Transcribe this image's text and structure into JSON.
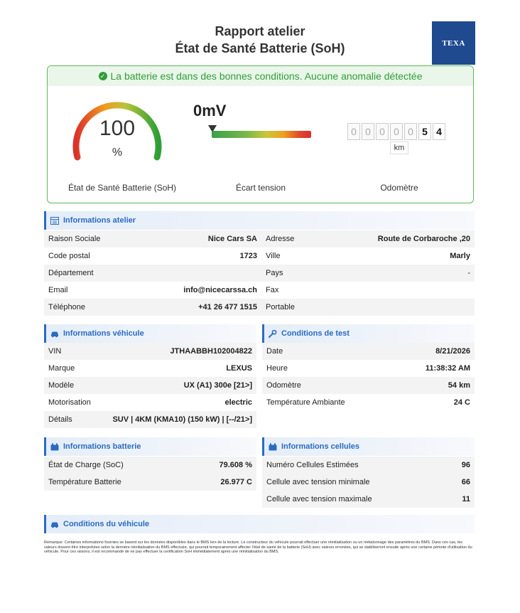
{
  "header": {
    "title_line1": "Rapport atelier",
    "title_line2": "État de Santé Batterie (SoH)",
    "logo_text": "TEXA"
  },
  "status": {
    "message": "La batterie est dans des bonnes conditions. Aucune anomalie détectée",
    "color": "#2e9e36"
  },
  "soh": {
    "value": "100",
    "unit": "%",
    "label": "État de Santé Batterie (SoH)",
    "level": 1.0
  },
  "voltage": {
    "value": "0mV",
    "label": "Écart tension",
    "marker_fraction": 0.0
  },
  "odometer": {
    "digits": [
      "0",
      "0",
      "0",
      "0",
      "0",
      "5",
      "4"
    ],
    "unit": "km",
    "label": "Odomètre"
  },
  "atelier": {
    "title": "Informations atelier",
    "rows": [
      {
        "k1": "Raison Sociale",
        "v1": "Nice Cars SA",
        "k2": "Adresse",
        "v2": "Route de Corbaroche ,20"
      },
      {
        "k1": "Code postal",
        "v1": "1723",
        "k2": "Ville",
        "v2": "Marly"
      },
      {
        "k1": "Département",
        "v1": "",
        "k2": "Pays",
        "v2": "-"
      },
      {
        "k1": "Email",
        "v1": "info@nicecarssa.ch",
        "k2": "Fax",
        "v2": ""
      },
      {
        "k1": "Téléphone",
        "v1": "+41 26 477 1515",
        "k2": "Portable",
        "v2": ""
      }
    ]
  },
  "vehicule": {
    "title": "Informations véhicule",
    "rows": [
      {
        "k": "VIN",
        "v": "JTHAABBH102004822"
      },
      {
        "k": "Marque",
        "v": "LEXUS"
      },
      {
        "k": "Modèle",
        "v": "UX (A1) 300e [21>]"
      },
      {
        "k": "Motorisation",
        "v": "electric"
      },
      {
        "k": "Détails",
        "v": "SUV | 4KM (KMA10) (150 kW) | [--/21>]"
      }
    ]
  },
  "test": {
    "title": "Conditions de test",
    "rows": [
      {
        "k": "Date",
        "v": "8/21/2026"
      },
      {
        "k": "Heure",
        "v": "11:38:32 AM"
      },
      {
        "k": "Odomètre",
        "v": "54 km"
      },
      {
        "k": "Température Ambiante",
        "v": "24 C"
      }
    ]
  },
  "batterie": {
    "title": "Informations batterie",
    "rows": [
      {
        "k": "État de Charge (SoC)",
        "v": "79.608 %"
      },
      {
        "k": "Température Batterie",
        "v": "26.977 C"
      }
    ]
  },
  "cellules": {
    "title": "Informations cellules",
    "rows": [
      {
        "k": "Numéro Cellules Estimées",
        "v": "96"
      },
      {
        "k": "Cellule avec tension minimale",
        "v": "66"
      },
      {
        "k": "Cellule avec tension maximale",
        "v": "11"
      }
    ]
  },
  "conditions": {
    "title": "Conditions du véhicule"
  },
  "note": "Remarque: Certaines informations fournies se basent sur les données disponibles dans le BMS lors de la lecture. Le constructeur du véhicule pourrait effectuer une réinitialisation ou un réétalonnage des paramètres du BMS. Dans ces cas, les valeurs doivent être interprétées selon la dernière réinitialisation du BMS effectuée, qui pourrait temporairement affecter l'état de santé de la batterie (SoH) avec valeurs erronées, qui se stabiliseront ensuite après une certaine période d'utilisation du véhicule. Pour ces raisons, il est recommandé de ne pas effectuer la certification SoH immédiatement après une réinitialisation du BMS."
}
